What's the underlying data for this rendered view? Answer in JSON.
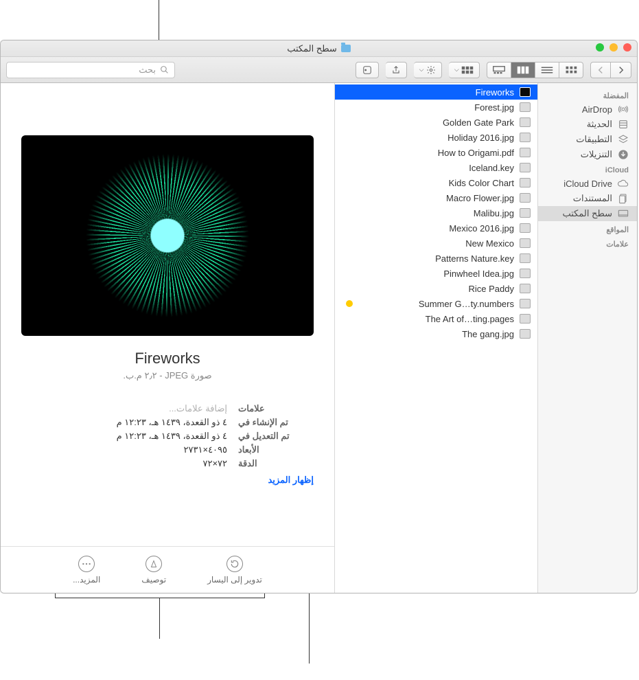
{
  "window_title": "سطح المكتب",
  "search_placeholder": "بحث",
  "sidebar": {
    "sections": [
      {
        "header": "المفضلة",
        "items": [
          {
            "label": "AirDrop",
            "icon": "airdrop"
          },
          {
            "label": "الحديثة",
            "icon": "recent"
          },
          {
            "label": "التطبيقات",
            "icon": "apps"
          },
          {
            "label": "التنزيلات",
            "icon": "downloads"
          }
        ]
      },
      {
        "header": "iCloud",
        "items": [
          {
            "label": "iCloud Drive",
            "icon": "cloud"
          },
          {
            "label": "المستندات",
            "icon": "docs"
          },
          {
            "label": "سطح المكتب",
            "icon": "desktop",
            "selected": true
          }
        ]
      },
      {
        "header": "المواقع",
        "items": []
      },
      {
        "header": "علامات",
        "items": []
      }
    ]
  },
  "files": [
    {
      "name": "Fireworks",
      "selected": true
    },
    {
      "name": "Forest.jpg"
    },
    {
      "name": "Golden Gate Park"
    },
    {
      "name": "Holiday 2016.jpg"
    },
    {
      "name": "How to Origami.pdf"
    },
    {
      "name": "Iceland.key"
    },
    {
      "name": "Kids Color Chart"
    },
    {
      "name": "Macro Flower.jpg"
    },
    {
      "name": "Malibu.jpg"
    },
    {
      "name": "Mexico 2016.jpg"
    },
    {
      "name": "New Mexico"
    },
    {
      "name": "Patterns Nature.key"
    },
    {
      "name": "Pinwheel Idea.jpg"
    },
    {
      "name": "Rice Paddy"
    },
    {
      "name": "Summer G…ty.numbers",
      "tagged": true
    },
    {
      "name": "The Art of…ting.pages"
    },
    {
      "name": "The gang.jpg"
    }
  ],
  "preview": {
    "title": "Fireworks",
    "subtitle": "صورة JPEG - ٢٫٢ م.ب.",
    "details": {
      "tags_label": "علامات",
      "tags_value": "إضافة علامات...",
      "created_label": "تم الإنشاء في",
      "created_value": "٤ ذو القعدة، ١٤٣٩ هـ، ١٢:٢٣ م",
      "modified_label": "تم التعديل في",
      "modified_value": "٤ ذو القعدة، ١٤٣٩ هـ، ١٢:٢٣ م",
      "dimensions_label": "الأبعاد",
      "dimensions_value": "٤٠٩٥×٢٧٣١",
      "resolution_label": "الدقة",
      "resolution_value": "٧٢×٧٢",
      "show_more": "إظهار المزيد"
    },
    "actions": {
      "rotate": "تدوير إلى اليسار",
      "markup": "توصيف",
      "more": "المزيد..."
    }
  }
}
